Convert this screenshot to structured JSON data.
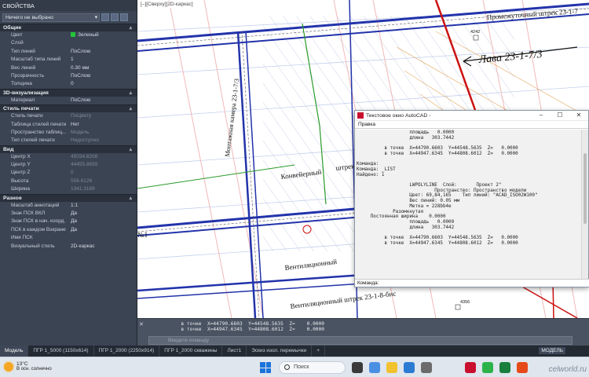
{
  "properties": {
    "title": "СВОЙСТВА",
    "selection": "Ничего не выбрано",
    "sections": [
      {
        "name": "Общие",
        "rows": [
          [
            "Цвет",
            "Зеленый"
          ],
          [
            "Слой",
            ""
          ],
          [
            "Тип линий",
            "ПоСлою"
          ],
          [
            "Масштаб типа линий",
            "1"
          ],
          [
            "Вес линий",
            "0.30 мм"
          ],
          [
            "Прозрачность",
            "ПоСлою"
          ],
          [
            "Толщина",
            "0"
          ]
        ]
      },
      {
        "name": "3D-визуализация",
        "rows": [
          [
            "Материал",
            "ПоСлою"
          ]
        ]
      },
      {
        "name": "Стиль печати",
        "rows": [
          [
            "Стиль печати",
            "ПоЦвету"
          ],
          [
            "Таблица стилей печати",
            "Нет"
          ],
          [
            "Пространство  таблиц...",
            "Модель"
          ],
          [
            "Тип стилей печати",
            "Недоступно"
          ]
        ]
      },
      {
        "name": "Вид",
        "rows": [
          [
            "Центр X",
            "45034.8208"
          ],
          [
            "Центр Y",
            "44455.8659"
          ],
          [
            "Центр Z",
            "0"
          ],
          [
            "Высота",
            "556.6126"
          ],
          [
            "Ширина",
            "1341.3189"
          ]
        ]
      },
      {
        "name": "Разное",
        "rows": [
          [
            "Масштаб аннотаций",
            "1:1"
          ],
          [
            "Знак ПСК ВКЛ",
            "Да"
          ],
          [
            "Знак ПСК в нач. коорд.",
            "Да"
          ],
          [
            "ПСК в каждом Вэкране",
            "Да"
          ],
          [
            "Имя ПСК",
            ""
          ],
          [
            "Визуальный стиль",
            "2D-каркас"
          ]
        ]
      }
    ],
    "color_swatch": "#22c43a"
  },
  "drawing": {
    "viewport_label": "[–][Сверху][2D-каркас]",
    "labels": {
      "promezh": "Промежуточный штрек 23-1-7",
      "lava": "Лава 23-1-7/3",
      "montazh": "Монтажная камера 23-1-7/3",
      "konv": "Конвейерный",
      "shtrek": "штрек",
      "vent1": "Вентиляционный",
      "vent2": "Вентиляционный  штрек 23-1-8-бис",
      "no1": "№1",
      "p4242": "4242",
      "p4356": "4356"
    }
  },
  "command": {
    "history": [
      "  в точке  X=44790.6603  Y=44548.5635  Z=    0.0000",
      "  в точке  X=44947.6345  Y=44808.6012  Z=    0.0000"
    ],
    "placeholder": "Введите команду"
  },
  "text_window": {
    "title": "Текстовое окно AutoCAD -",
    "menu": "Правка",
    "lines": [
      "                   площадь   0.0000",
      "                   длина   303.7442",
      "",
      "          в точке  X=44790.6603  Y=44548.5635  Z=   0.0000",
      "          в точке  X=44947.6345  Y=44808.6012  Z=   0.0000",
      "",
      "Команда:",
      "Команда: _LIST",
      "Найдено: 1",
      "",
      "                   LWPOLYLINE  Слой:       Проект 2\"",
      "                            Пространство: Пространство модели",
      "                   Цвет: 69,84,165    Тип линий: \"ACAD_ISO02W100\"",
      "                   Вес линий: 0.05 мм",
      "                   Метка = 228bb4e",
      "             Разомкнутая",
      "     Постоянная ширина    0.0000",
      "                   площадь   0.0000",
      "                   длина   303.7442",
      "",
      "          в точке  X=44790.6603  Y=44548.5635  Z=   0.0000",
      "          в точке  X=44947.6345  Y=44808.6012  Z=   0.0000"
    ],
    "cmd_label": "Команда:"
  },
  "tabs": [
    "Модель",
    "ПГР 1_5000 (1150х614)",
    "ПГР 1_2000 (2250х914)",
    "ПГР 1_2000 скважины",
    "Лист1",
    "Эскиз изол. перемычки",
    "+"
  ],
  "mode_label": "МОДЕЛЬ",
  "taskbar": {
    "temp": "13°C",
    "weather": "В осн. солнечно",
    "search": "Поиск",
    "watermark": "celworld.ru"
  }
}
